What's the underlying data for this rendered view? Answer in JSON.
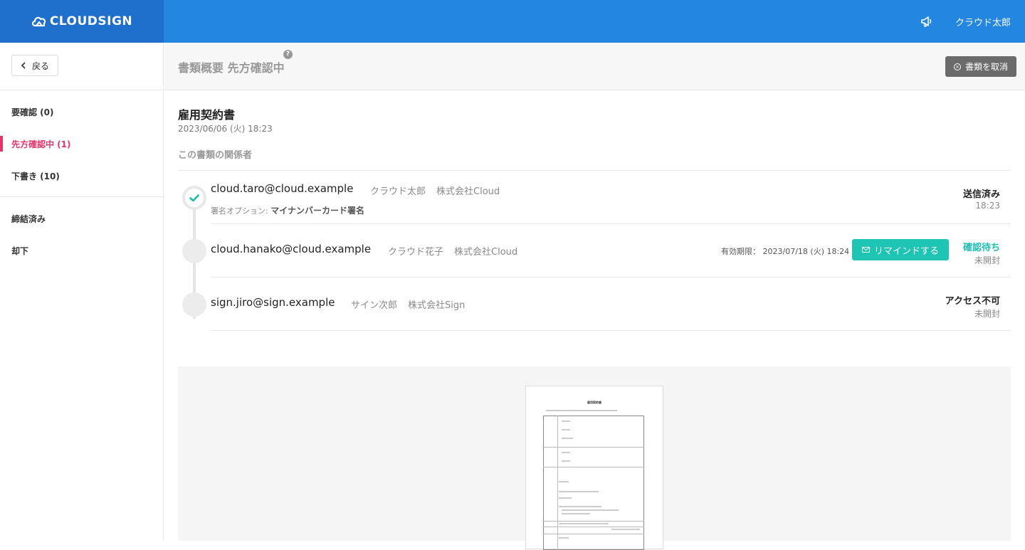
{
  "header": {
    "logo_text": "CLOUDSIGN",
    "user_name": "クラウド太郎",
    "announce_icon": "megaphone-icon"
  },
  "sidebar": {
    "back_label": "戻る",
    "items": [
      {
        "label": "要確認 (0)",
        "active": false
      },
      {
        "label": "先方確認中 (1)",
        "active": true
      },
      {
        "label": "下書き (10)",
        "active": false
      },
      {
        "label": "締結済み",
        "active": false
      },
      {
        "label": "却下",
        "active": false
      }
    ]
  },
  "main": {
    "title": "書類概要 先方確認中",
    "help_icon": "?",
    "cancel_label": "書類を取消",
    "document": {
      "title": "雇用契約書",
      "date": "2023/06/06 (火) 18:23"
    },
    "parties_label": "この書類の関係者",
    "parties": [
      {
        "email": "cloud.taro@cloud.example",
        "name": "クラウド太郎",
        "company": "株式会社Cloud",
        "sign_option_label": "署名オプション:",
        "sign_option_value": "マイナンバーカード署名",
        "status": "送信済み",
        "status_sub": "18:23"
      },
      {
        "email": "cloud.hanako@cloud.example",
        "name": "クラウド花子",
        "company": "株式会社Cloud",
        "expiry_label": "有効期限：",
        "expiry_value": "2023/07/18 (火) 18:24",
        "remind_label": "リマインドする",
        "status": "確認待ち",
        "status_sub": "未開封"
      },
      {
        "email": "sign.jiro@sign.example",
        "name": "サイン次郎",
        "company": "株式会社Sign",
        "status": "アクセス不可",
        "status_sub": "未開封"
      }
    ],
    "preview": {
      "paper_title": "雇用契約書"
    }
  },
  "colors": {
    "topbar": "#2386e0",
    "logo_bg": "#1f6fcc",
    "active_nav": "#e8336a",
    "teal": "#1ec4b4",
    "cancel_btn": "#6b6b6b"
  }
}
